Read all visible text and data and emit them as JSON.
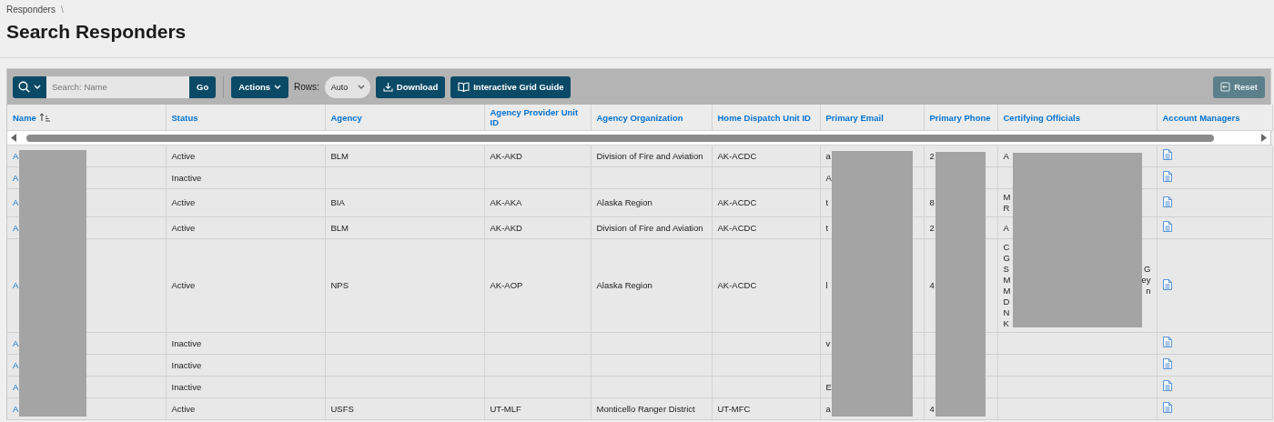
{
  "breadcrumb": {
    "items": [
      "Responders"
    ],
    "separator": "\\"
  },
  "title": "Search Responders",
  "toolbar": {
    "search_placeholder": "Search: Name",
    "go": "Go",
    "actions": "Actions",
    "rows_label": "Rows:",
    "rows_value": "Auto",
    "download": "Download",
    "guide": "Interactive Grid Guide",
    "reset": {
      "label": "Reset",
      "disabled": true
    }
  },
  "table": {
    "columns": [
      {
        "label": "Name",
        "sorted": true
      },
      {
        "label": "Status",
        "sorted": false
      },
      {
        "label": "Agency",
        "sorted": false
      },
      {
        "label": "Agency Provider Unit ID",
        "sorted": false
      },
      {
        "label": "Agency Organization",
        "sorted": false
      },
      {
        "label": "Home Dispatch Unit ID",
        "sorted": false
      },
      {
        "label": "Primary Email",
        "sorted": false
      },
      {
        "label": "Primary Phone",
        "sorted": false
      },
      {
        "label": "Certifying Officials",
        "sorted": false
      },
      {
        "label": "Account Managers",
        "sorted": false
      }
    ],
    "rows": [
      {
        "name": "A",
        "status": "Active",
        "agency": "BLM",
        "provider_unit": "AK-AKD",
        "organization": "Division of Fire and Aviation",
        "dispatch_unit": "AK-ACDC",
        "email": "a",
        "phone": "2",
        "certifying": [
          {
            "left": "A"
          }
        ]
      },
      {
        "name": "A",
        "status": "Inactive",
        "email": "A",
        "certifying": []
      },
      {
        "name": "A",
        "status": "Active",
        "agency": "BIA",
        "provider_unit": "AK-AKA",
        "organization": "Alaska Region",
        "dispatch_unit": "AK-ACDC",
        "email": "t",
        "phone": "8",
        "certifying": [
          {
            "left": "M"
          },
          {
            "left": "R"
          }
        ]
      },
      {
        "name": "A",
        "status": "Active",
        "agency": "BLM",
        "provider_unit": "AK-AKD",
        "organization": "Division of Fire and Aviation",
        "dispatch_unit": "AK-ACDC",
        "email": "t",
        "phone": "2",
        "certifying": [
          {
            "left": "A"
          }
        ]
      },
      {
        "name": "A",
        "status": "Active",
        "agency": "NPS",
        "provider_unit": "AK-AOP",
        "organization": "Alaska Region",
        "dispatch_unit": "AK-ACDC",
        "email": "l",
        "phone": "4",
        "certifying": [
          {
            "left": "C"
          },
          {
            "left": "G"
          },
          {
            "left": "S",
            "right": "G"
          },
          {
            "left": "M",
            "right": "ey"
          },
          {
            "left": "M",
            "right": "n"
          },
          {
            "left": "D"
          },
          {
            "left": "N"
          },
          {
            "left": "K"
          }
        ]
      },
      {
        "name": "A",
        "status": "Inactive",
        "email": "v",
        "certifying": []
      },
      {
        "name": "A",
        "status": "Inactive",
        "certifying": []
      },
      {
        "name": "A",
        "status": "Inactive",
        "email": "E",
        "certifying": []
      },
      {
        "name": "A",
        "status": "Active",
        "agency": "USFS",
        "provider_unit": "UT-MLF",
        "organization": "Monticello Ranger District",
        "dispatch_unit": "UT-MFC",
        "email": "a",
        "phone": "4",
        "certifying": []
      }
    ]
  }
}
